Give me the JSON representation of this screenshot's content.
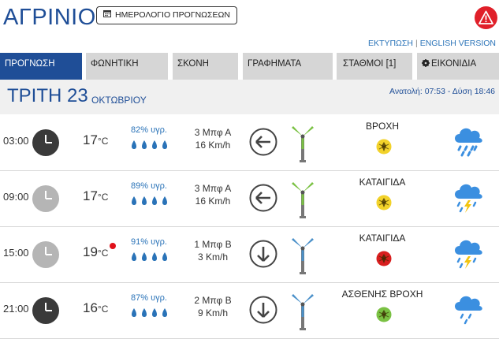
{
  "header": {
    "city": "ΑΓΡΙΝΙΟ",
    "calendar_button": "ΗΜΕΡΟΛΟΓΙΟ ΠΡΟΓΝΩΣΕΩΝ",
    "print_link": "ΕΚΤΥΠΩΣΗ",
    "separator": "|",
    "english_link": "ENGLISH VERSION"
  },
  "tabs": [
    {
      "label": "ΠΡΟΓΝΩΣΗ",
      "active": true
    },
    {
      "label": "ΦΩΝΗΤΙΚΗ",
      "active": false
    },
    {
      "label": "ΣΚΟΝΗ",
      "active": false
    },
    {
      "label": "ΓΡΑΦΗΜΑΤΑ",
      "active": false
    },
    {
      "label": "ΣΤΑΘΜΟΙ [1]",
      "active": false
    },
    {
      "label": "ΕΙΚΟΝΙΔΙΑ",
      "active": false
    }
  ],
  "day": {
    "name": "ΤΡΙΤΗ 23",
    "month": "ΟΚΤΩΒΡΙΟΥ",
    "sun": "Ανατολή: 07:53  - Δύση 18:46"
  },
  "colors": {
    "brand_blue": "#1f4e97",
    "link_blue": "#2a73b8",
    "alert_red": "#e0202a",
    "warning_yellow": "#f2d22a",
    "warning_red": "#d81e1e",
    "warning_green": "#7ac143"
  },
  "forecast": [
    {
      "time": "03:00",
      "clock_style": "night",
      "temp": "17",
      "unit": "°C",
      "humidity": "82% υγρ.",
      "wind_beaufort": "3 Μπφ Α",
      "wind_speed": "16 Km/h",
      "wind_dir_icon": "arrow-left-icon",
      "weather": "ΒΡΟΧΗ",
      "warning_level": "yellow",
      "weather_icon": "rain-cloud-icon",
      "record_temp": false
    },
    {
      "time": "09:00",
      "clock_style": "day",
      "temp": "17",
      "unit": "°C",
      "humidity": "89% υγρ.",
      "wind_beaufort": "3 Μπφ Α",
      "wind_speed": "16 Km/h",
      "wind_dir_icon": "arrow-left-icon",
      "weather": "ΚΑΤΑΙΓΙΔΑ",
      "warning_level": "yellow",
      "weather_icon": "thunderstorm-cloud-icon",
      "record_temp": false
    },
    {
      "time": "15:00",
      "clock_style": "day",
      "temp": "19",
      "unit": "°C",
      "humidity": "91% υγρ.",
      "wind_beaufort": "1 Μπφ Β",
      "wind_speed": "3 Km/h",
      "wind_dir_icon": "arrow-down-icon",
      "weather": "ΚΑΤΑΙΓΙΔΑ",
      "warning_level": "red",
      "weather_icon": "thunderstorm-cloud-icon",
      "record_temp": true
    },
    {
      "time": "21:00",
      "clock_style": "night",
      "temp": "16",
      "unit": "°C",
      "humidity": "87% υγρ.",
      "wind_beaufort": "2 Μπφ Β",
      "wind_speed": "9 Km/h",
      "wind_dir_icon": "arrow-down-icon",
      "weather": "ΑΣΘΕΝΗΣ ΒΡΟΧΗ",
      "warning_level": "green",
      "weather_icon": "light-rain-cloud-icon",
      "record_temp": false
    }
  ]
}
